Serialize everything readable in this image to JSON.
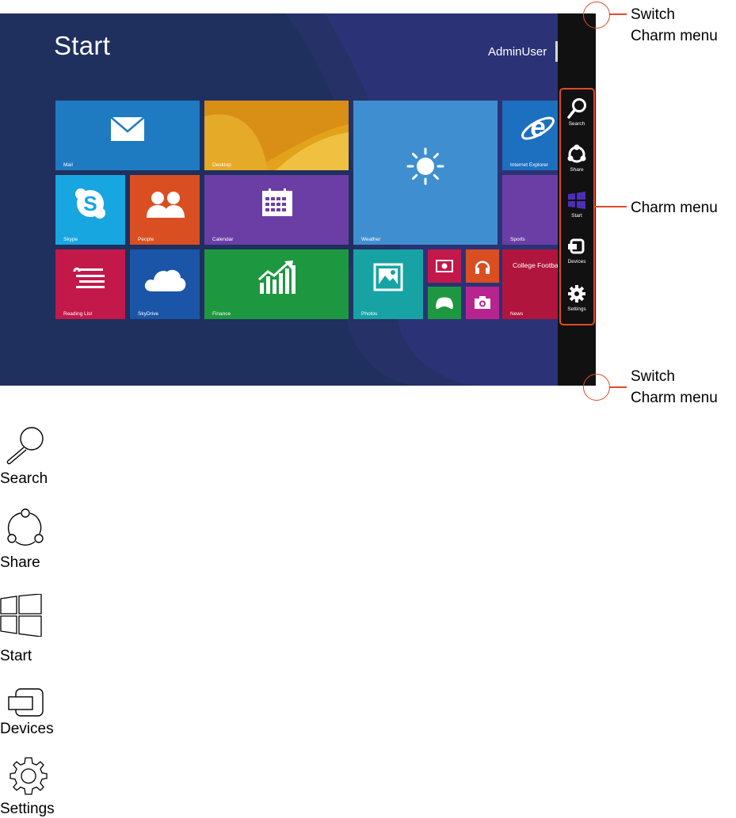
{
  "start_screen": {
    "title": "Start",
    "user_name": "AdminUser"
  },
  "tiles": [
    {
      "id": "mail",
      "label": "Mail",
      "color": "#1e7bc2",
      "icon": "mail-icon"
    },
    {
      "id": "desktop",
      "label": "Desktop",
      "color": "#e2a21b",
      "icon": "none"
    },
    {
      "id": "weather",
      "label": "Weather",
      "color": "#3f8fd0",
      "icon": "sun-icon"
    },
    {
      "id": "ie",
      "label": "Internet Explorer",
      "color": "#1d6fc0",
      "icon": "internet-explorer-icon"
    },
    {
      "id": "skype",
      "label": "Skype",
      "color": "#18a6e0",
      "icon": "skype-icon"
    },
    {
      "id": "people",
      "label": "People",
      "color": "#d94f21",
      "icon": "people-icon"
    },
    {
      "id": "calendar",
      "label": "Calendar",
      "color": "#6b3ea6",
      "icon": "calendar-icon"
    },
    {
      "id": "sports",
      "label": "Sports",
      "color": "#6b3ea6",
      "icon": "none"
    },
    {
      "id": "reading",
      "label": "Reading List",
      "color": "#c2194a",
      "icon": "reading-list-icon"
    },
    {
      "id": "skydrive",
      "label": "SkyDrive",
      "color": "#1a55a8",
      "icon": "cloud-icon"
    },
    {
      "id": "finance",
      "label": "Finance",
      "color": "#1e9840",
      "icon": "finance-chart-icon"
    },
    {
      "id": "photos",
      "label": "Photos",
      "color": "#17a3a3",
      "icon": "photo-icon"
    },
    {
      "id": "video",
      "label": "",
      "color": "#c2194a",
      "icon": "video-icon"
    },
    {
      "id": "music",
      "label": "",
      "color": "#d94f21",
      "icon": "headphones-icon"
    },
    {
      "id": "games",
      "label": "",
      "color": "#1e9840",
      "icon": "game-controller-icon"
    },
    {
      "id": "camera",
      "label": "",
      "color": "#b8248f",
      "icon": "camera-icon"
    },
    {
      "id": "news",
      "label": "News",
      "headline": "College Footba",
      "color": "#b0153e",
      "icon": "none"
    }
  ],
  "charms": [
    {
      "label": "Search",
      "icon": "search-icon"
    },
    {
      "label": "Share",
      "icon": "share-icon"
    },
    {
      "label": "Start",
      "icon": "windows-logo-icon"
    },
    {
      "label": "Devices",
      "icon": "devices-icon"
    },
    {
      "label": "Settings",
      "icon": "gear-icon"
    }
  ],
  "callouts": {
    "top": {
      "line1": "Switch",
      "line2": "Charm menu"
    },
    "middle": {
      "text": "Charm menu"
    },
    "bottom": {
      "line1": "Switch",
      "line2": "Charm menu"
    }
  },
  "legend": [
    {
      "label": "Search",
      "icon": "search-icon"
    },
    {
      "label": "Share",
      "icon": "share-icon"
    },
    {
      "label": "Start",
      "icon": "windows-logo-icon"
    },
    {
      "label": "Devices",
      "icon": "devices-icon"
    },
    {
      "label": "Settings",
      "icon": "gear-icon"
    }
  ],
  "colors": {
    "background": "#1f2f5e",
    "charm_bar": "#111111",
    "accent": "#e0492a"
  }
}
